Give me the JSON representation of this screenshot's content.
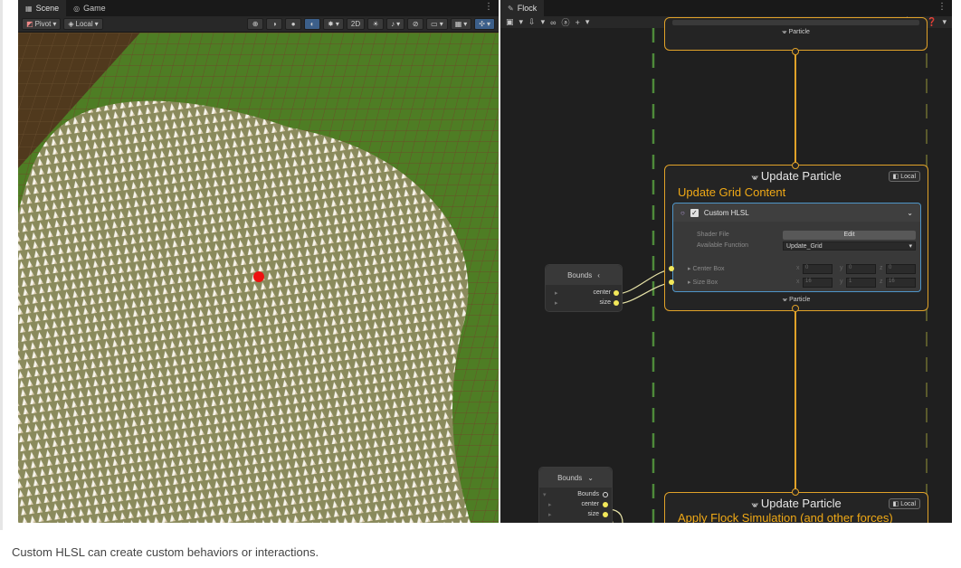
{
  "scene": {
    "tabs": [
      {
        "label": "Scene",
        "icon": "scene-icon"
      },
      {
        "label": "Game",
        "icon": "game-icon"
      }
    ],
    "pivot_label": "Pivot",
    "local_label": "Local",
    "mode_2d_label": "2D"
  },
  "graph": {
    "tab_label": "Flock",
    "top_context": {
      "port_label": "Particle"
    },
    "update_context": {
      "title": "Update Particle",
      "subtitle": "Update Grid Content",
      "local_label": "Local",
      "port_label": "Particle",
      "block": {
        "title": "Custom HLSL",
        "shader_file_label": "Shader File",
        "edit_label": "Edit",
        "available_function_label": "Available Function",
        "function_value": "Update_Grid",
        "center_box_label": "Center Box",
        "size_box_label": "Size Box",
        "center": {
          "x": "0",
          "y": "0",
          "z": "0"
        },
        "size": {
          "x": "16",
          "y": "1",
          "z": "16"
        }
      }
    },
    "bounds_node_1": {
      "title": "Bounds",
      "ports": [
        "center",
        "size"
      ]
    },
    "bounds_node_2": {
      "title": "Bounds",
      "root_port": "Bounds",
      "ports": [
        "center",
        "size"
      ]
    },
    "bottom_context": {
      "title": "Update Particle",
      "subtitle": "Apply Flock Simulation (and other forces)",
      "local_label": "Local"
    }
  },
  "caption": "Custom HLSL can create custom behaviors or interactions.",
  "colors": {
    "accent_orange": "#f0a916",
    "edge_yellow": "#f2e85a",
    "grass_green": "#4e7d24",
    "ground_brown": "#4e3a1e",
    "selection_blue": "#4f95c8"
  }
}
